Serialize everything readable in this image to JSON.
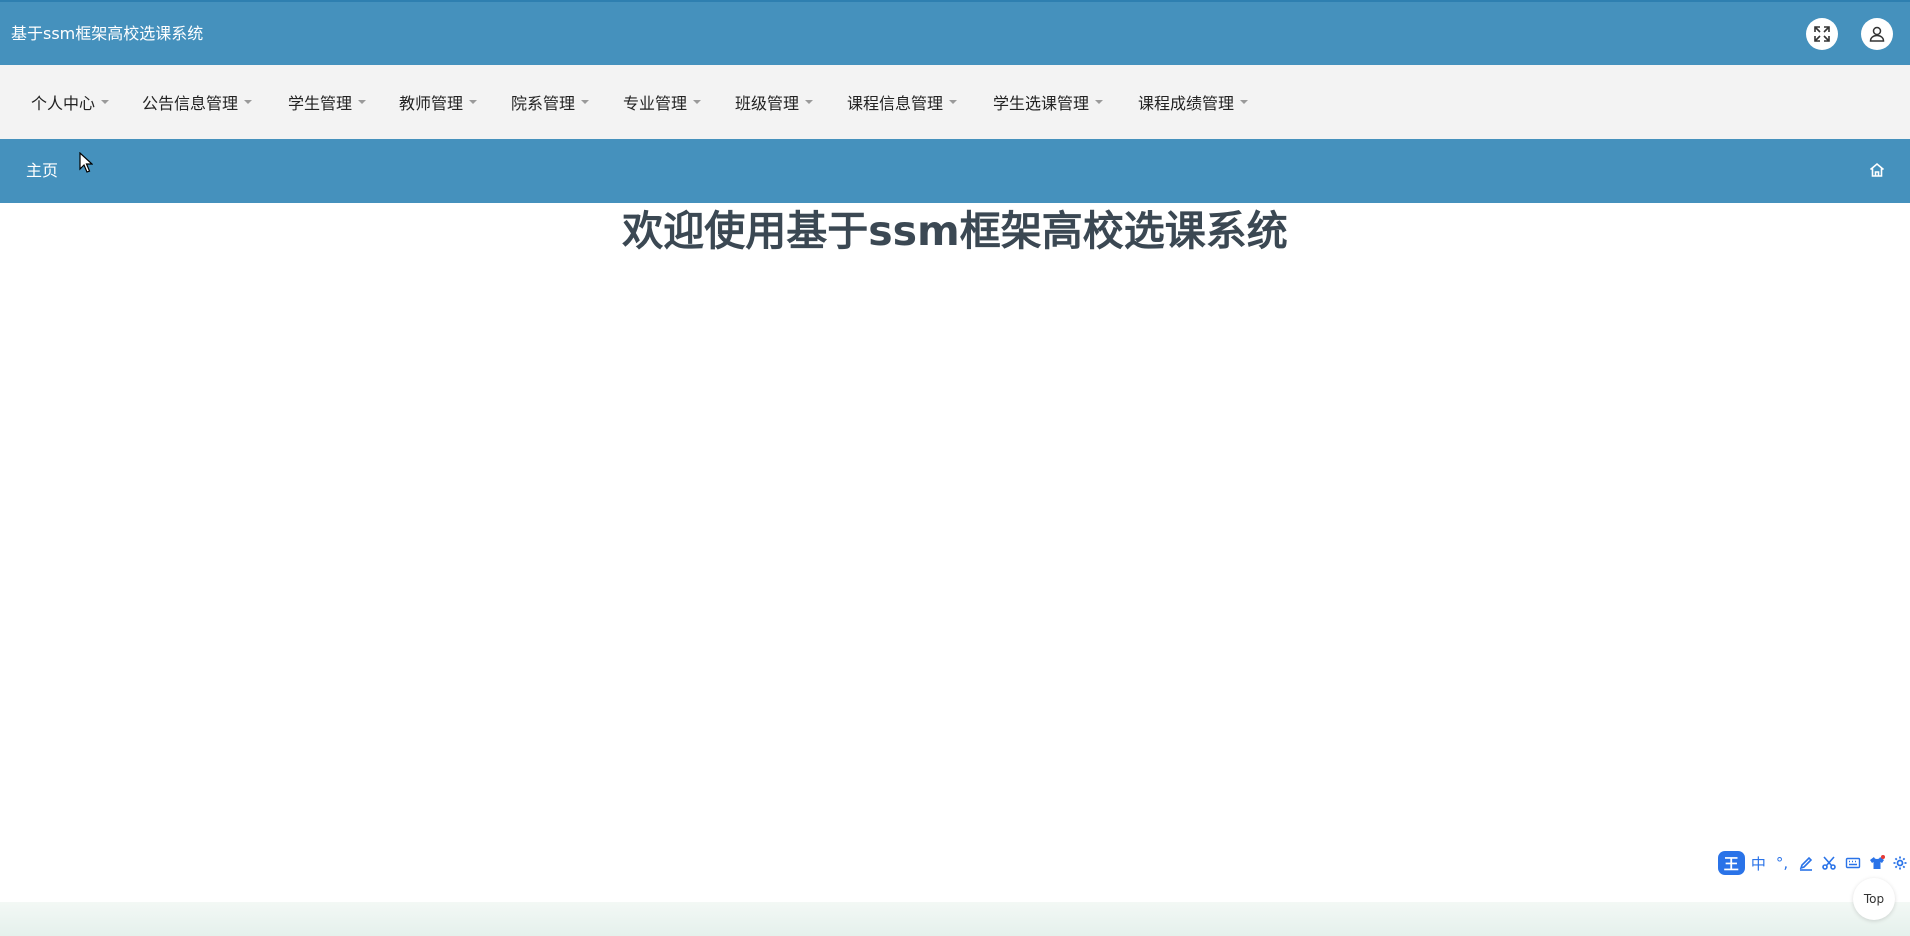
{
  "header": {
    "app_title": "基于ssm框架高校选课系统",
    "fullscreen_icon": "fullscreen-icon",
    "user_icon": "user-icon"
  },
  "nav": {
    "items": [
      {
        "label": "个人中心"
      },
      {
        "label": "公告信息管理"
      },
      {
        "label": "学生管理"
      },
      {
        "label": "教师管理"
      },
      {
        "label": "院系管理"
      },
      {
        "label": "专业管理"
      },
      {
        "label": "班级管理"
      },
      {
        "label": "课程信息管理"
      },
      {
        "label": "学生选课管理"
      },
      {
        "label": "课程成绩管理"
      }
    ]
  },
  "breadcrumb": {
    "current": "主页",
    "home_icon": "home-icon"
  },
  "main": {
    "welcome_title": "欢迎使用基于ssm框架高校选课系统"
  },
  "ime_toolbar": {
    "logo": "王",
    "lang_label": "中",
    "punct_label": "°,",
    "icons": [
      "pen-icon",
      "scissors-icon",
      "keyboard-icon",
      "shirt-icon",
      "gear-icon"
    ]
  },
  "back_to_top": {
    "label": "Top"
  },
  "colors": {
    "primary_bar": "#4591bd",
    "nav_background": "#f3f3f3",
    "title_text": "#3b4853",
    "ime_blue": "#2a73e8"
  }
}
